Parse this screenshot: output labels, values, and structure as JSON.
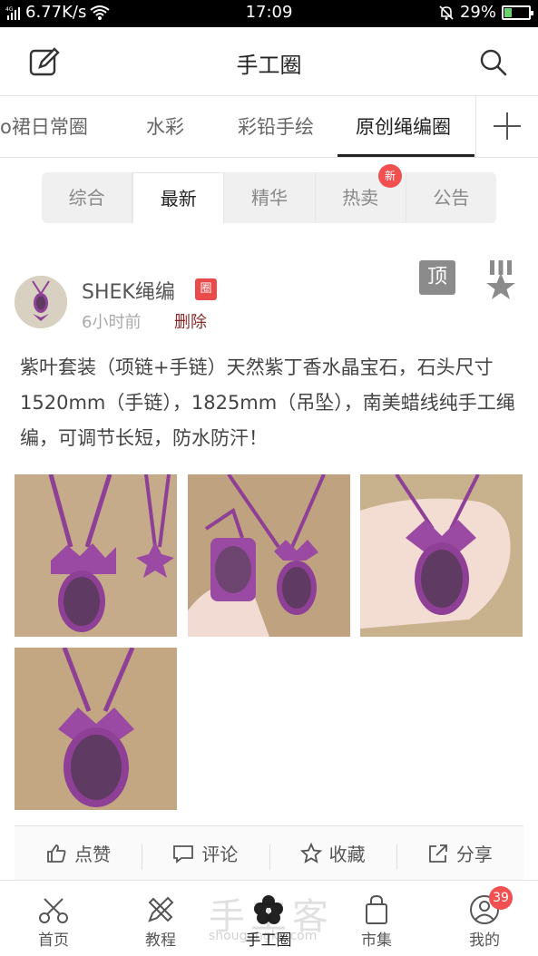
{
  "status_bar": {
    "network_speed": "6.77K/s",
    "time": "17:09",
    "battery": "29%",
    "battery_level": 0.29
  },
  "header": {
    "title": "手工圈",
    "edit_icon": "edit-icon",
    "search_icon": "search-icon"
  },
  "channels": {
    "tabs": [
      {
        "label": "o裙日常圈"
      },
      {
        "label": "水彩"
      },
      {
        "label": "彩铅手绘"
      },
      {
        "label": "原创绳编圈",
        "active": true
      }
    ],
    "add_icon": "plus-icon"
  },
  "filter": {
    "segments": [
      {
        "label": "综合"
      },
      {
        "label": "最新",
        "active": true
      },
      {
        "label": "精华"
      },
      {
        "label": "热卖"
      },
      {
        "label": "公告"
      }
    ],
    "new_badge": "新"
  },
  "post": {
    "username": "SHEK绳编",
    "circle_badge": "圈",
    "time": "6小时前",
    "delete_label": "删除",
    "top_label": "顶",
    "medal_icon": "medal-icon",
    "content": "紫叶套装（项链+手链）天然紫丁香水晶宝石，石头尺寸1520mm（手链），1825mm（吊坠），南美蜡线纯手工绳编，可调节长短，防水防汗！",
    "photos": [
      "photo-1",
      "photo-2",
      "photo-3",
      "photo-4"
    ]
  },
  "actions": [
    {
      "label": "点赞",
      "icon": "thumbs-up-icon"
    },
    {
      "label": "评论",
      "icon": "comment-icon"
    },
    {
      "label": "收藏",
      "icon": "star-icon"
    },
    {
      "label": "分享",
      "icon": "share-icon"
    }
  ],
  "bottom_nav": {
    "items": [
      {
        "label": "首页",
        "icon": "scissors-icon"
      },
      {
        "label": "教程",
        "icon": "pencil-ruler-icon"
      },
      {
        "label": "手工圈",
        "icon": "flower-icon",
        "active": true
      },
      {
        "label": "市集",
        "icon": "shopping-bag-icon"
      },
      {
        "label": "我的",
        "icon": "user-icon"
      }
    ],
    "profile_badge": "39",
    "watermark": "手工客",
    "watermark_url": "shougongke.com"
  },
  "colors": {
    "accent_red": "#f05050",
    "thread_purple": "#8e3f96",
    "stone_purple": "#5f3a62"
  }
}
